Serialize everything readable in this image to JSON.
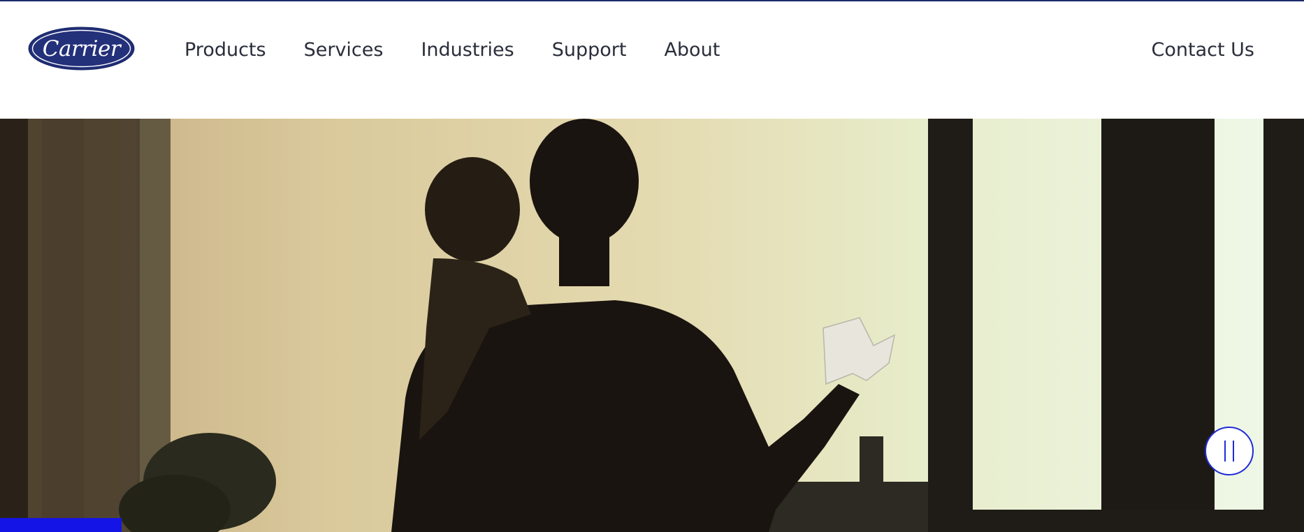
{
  "brand": {
    "logo_text": "Carrier",
    "logo_color": "#1b2a6b"
  },
  "nav": {
    "items": [
      {
        "label": "Products"
      },
      {
        "label": "Services"
      },
      {
        "label": "Industries"
      },
      {
        "label": "Support"
      },
      {
        "label": "About"
      }
    ],
    "contact_label": "Contact Us"
  },
  "hero": {
    "media": "video",
    "controls": {
      "pause_icon": "pause-icon",
      "accent_color": "#1f2ad8"
    },
    "progress_fraction": 0.093
  }
}
